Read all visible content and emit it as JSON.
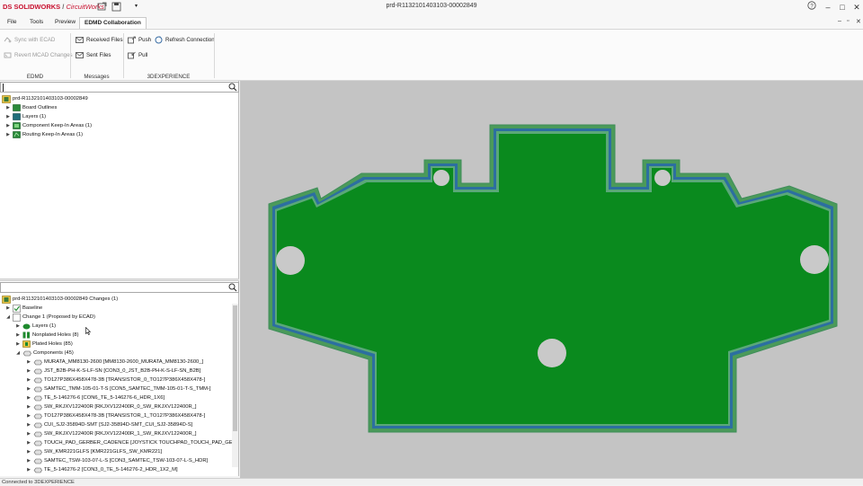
{
  "app": {
    "brand_ds": "DS SOLIDWORKS",
    "brand_sep": " / ",
    "brand_product": "CircuitWorks",
    "window_title": "prd-R1132101403103-00002849"
  },
  "window_controls": {
    "help": "?",
    "minimize": "–",
    "maximize": "□",
    "close": "✕",
    "mdi_minimize": "–",
    "mdi_restore": "▫",
    "mdi_close": "✕"
  },
  "menu": {
    "file": "File",
    "tools": "Tools",
    "preview": "Preview",
    "edmd": "EDMD Collaboration"
  },
  "ribbon": {
    "sync_ecad": "Sync with ECAD",
    "revert_mcad": "Revert MCAD Changes",
    "received_files": "Received Files",
    "sent_files": "Sent Files",
    "push": "Push",
    "refresh_connection": "Refresh Connection",
    "pull": "Pull",
    "group_edmd": "EDMD",
    "group_messages": "Messages",
    "group_3dx": "3DEXPERIENCE"
  },
  "top_tree": {
    "search_value": "",
    "root": "prd-R1132101403103-00002849",
    "items": [
      "Board Outlines",
      "Layers (1)",
      "Component Keep-In Areas (1)",
      "Routing Keep-In Areas (1)"
    ]
  },
  "bottom_tree": {
    "search_value": "",
    "root": "prd-R1132101403103-00002849  Changes  (1)",
    "baseline": "Baseline",
    "change": "Change 1 (Proposed by ECAD)",
    "change_items": [
      "Layers (1)",
      "Nonplated Holes (8)",
      "Plated Holes (85)",
      "Components (45)"
    ],
    "components": [
      "MURATA_MM8130-2600 [MM8130-2600_MURATA_MM8130-2600_]",
      "JST_B2B-PH-K-S-LF-SN [CON3_0_JST_B2B-PH-K-S-LF-SN_B2B]",
      "TO127P386X458X478-3B [TRANSISTOR_0_TO127P386X458X478-]",
      "SAMTEC_TMM-105-01-T-S [CON5_SAMTEC_TMM-105-01-T-S_TMM-]",
      "TE_5-146276-6 [CON6_TE_5-146276-6_HDR_1X6]",
      "SW_RKJXV122400R [RKJXV122400R_0_SW_RKJXV122400R_]",
      "TO127P386X458X478-3B [TRANSISTOR_1_TO127P386X458X478-]",
      "CUI_SJ2-35894D-SMT [SJ2-35894D-SMT_CUI_SJ2-35894D-S]",
      "SW_RKJXV122400R [RKJXV122400R_1_SW_RKJXV122400R_]",
      "TOUCH_PAD_GERBER_CADENCE [JOYSTICK TOUCHPAD_TOUCH_PAD_GER]",
      "SW_KMR221GLFS [KMR221GLFS_SW_KMR221]",
      "SAMTEC_TSW-103-07-L-S [CON3_SAMTEC_TSW-103-07-L-S_HDR]",
      "TE_5-146276-2 [CON3_0_TE_5-146276-2_HDR_1X2_M]"
    ]
  },
  "status": {
    "text": "Connected to 3DEXPERIENCE"
  },
  "colors": {
    "board_green": "#0a8a1e",
    "board_edge": "#3f8e5a",
    "board_blue": "#2c6fa0",
    "canvas_bg": "#c4c4c4",
    "hole": "#c9c9c9"
  }
}
